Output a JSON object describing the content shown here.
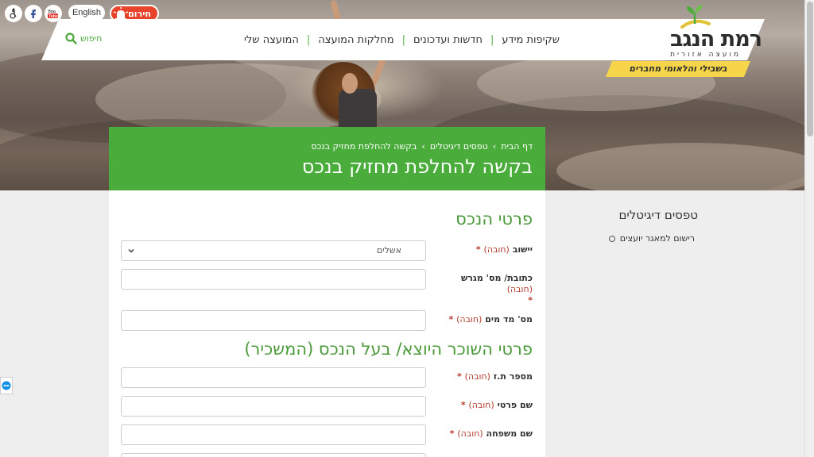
{
  "top_controls": {
    "english_label": "English",
    "emergency_label": "חירום",
    "icons": [
      "accessibility-icon",
      "facebook-icon",
      "youtube-icon",
      "siren-icon"
    ]
  },
  "logo": {
    "name": "רמת הנגב",
    "subtitle": "מועצה אזורית",
    "tagline": "בשבילי והלאומי מחברים"
  },
  "nav": {
    "items": [
      "המועצה שלי",
      "מחלקות המועצה",
      "חדשות ועדכונים",
      "שקיפות מידע"
    ],
    "search_label": "חיפוש"
  },
  "header": {
    "breadcrumb": [
      "דף הבית",
      "טפסים דיגיטלים",
      "בקשה להחלפת מחזיק בנכס"
    ],
    "title": "בקשה להחלפת מחזיק בנכס"
  },
  "form": {
    "section1_title": "פרטי הנכס",
    "section2_title": "פרטי השוכר היוצא/ בעל הנכס (המשכיר)",
    "required_text": "(חובה)",
    "fields": [
      {
        "label": "יישוב",
        "value": "אשלים"
      },
      {
        "label": "כתובת/ מס' מגרש",
        "value": ""
      },
      {
        "label": "מס' מד מים",
        "value": ""
      },
      {
        "label": "מספר ת.ז",
        "value": ""
      },
      {
        "label": "שם פרטי",
        "value": ""
      },
      {
        "label": "שם משפחה",
        "value": ""
      }
    ]
  },
  "sidebar": {
    "title": "טפסים דיגיטלים",
    "items": [
      "רישום למאגר יועצים"
    ]
  },
  "colors": {
    "brand_green": "#4aad3b",
    "section_green": "#4a9a39",
    "required_red": "#b53a2b",
    "emergency_red": "#e8442c",
    "tagline_yellow": "#f6d54a"
  }
}
